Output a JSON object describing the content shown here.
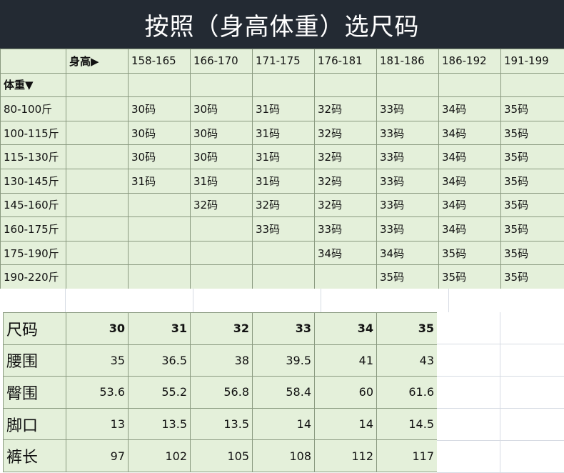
{
  "title": "按照（身高体重）选尺码",
  "grid": {
    "height_label": "身高▶",
    "weight_label": "体重▼",
    "heights": [
      "158-165",
      "166-170",
      "171-175",
      "176-181",
      "181-186",
      "186-192",
      "191-199"
    ],
    "rows": [
      {
        "weight": "80-100斤",
        "cells": [
          "30码",
          "30码",
          "31码",
          "32码",
          "33码",
          "34码",
          "35码"
        ]
      },
      {
        "weight": "100-115斤",
        "cells": [
          "30码",
          "30码",
          "31码",
          "32码",
          "33码",
          "34码",
          "35码"
        ]
      },
      {
        "weight": "115-130斤",
        "cells": [
          "30码",
          "30码",
          "31码",
          "32码",
          "33码",
          "34码",
          "35码"
        ]
      },
      {
        "weight": "130-145斤",
        "cells": [
          "31码",
          "31码",
          "31码",
          "32码",
          "33码",
          "34码",
          "35码"
        ]
      },
      {
        "weight": "145-160斤",
        "cells": [
          "",
          "32码",
          "32码",
          "32码",
          "33码",
          "34码",
          "35码"
        ]
      },
      {
        "weight": "160-175斤",
        "cells": [
          "",
          "",
          "33码",
          "33码",
          "33码",
          "34码",
          "35码"
        ]
      },
      {
        "weight": "175-190斤",
        "cells": [
          "",
          "",
          "",
          "34码",
          "34码",
          "35码",
          "35码"
        ]
      },
      {
        "weight": "190-220斤",
        "cells": [
          "",
          "",
          "",
          "",
          "35码",
          "35码",
          "35码"
        ]
      }
    ]
  },
  "measurements": {
    "rows": [
      {
        "label": "尺码",
        "values": [
          "30",
          "31",
          "32",
          "33",
          "34",
          "35"
        ]
      },
      {
        "label": "腰围",
        "values": [
          "35",
          "36.5",
          "38",
          "39.5",
          "41",
          "43"
        ]
      },
      {
        "label": "臀围",
        "values": [
          "53.6",
          "55.2",
          "56.8",
          "58.4",
          "60",
          "61.6"
        ]
      },
      {
        "label": "脚口",
        "values": [
          "13",
          "13.5",
          "13.5",
          "14",
          "14",
          "14.5"
        ]
      },
      {
        "label": "裤长",
        "values": [
          "97",
          "102",
          "105",
          "108",
          "112",
          "117"
        ]
      }
    ]
  }
}
